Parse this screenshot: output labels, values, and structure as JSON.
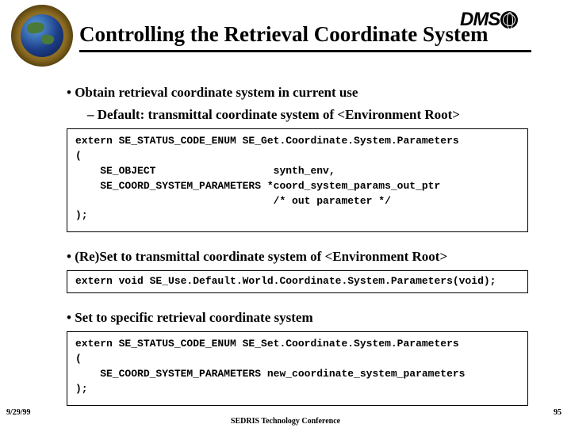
{
  "header": {
    "title": "Controlling the Retrieval Coordinate System",
    "brand_right": {
      "pre": "DMS",
      "post": ""
    }
  },
  "bullets": {
    "b1": "• Obtain retrieval coordinate system in current use",
    "b1_sub": "– Default: transmittal coordinate system of <Environment Root>",
    "b2": "• (Re)Set to transmittal coordinate system of <Environment Root>",
    "b3": "• Set to specific retrieval coordinate system"
  },
  "code": {
    "c1": "extern SE_STATUS_CODE_ENUM SE_Get.Coordinate.System.Parameters\n(\n    SE_OBJECT                   synth_env,\n    SE_COORD_SYSTEM_PARAMETERS *coord_system_params_out_ptr\n                                /* out parameter */\n);",
    "c2": "extern void SE_Use.Default.World.Coordinate.System.Parameters(void);",
    "c3": "extern SE_STATUS_CODE_ENUM SE_Set.Coordinate.System.Parameters\n(\n    SE_COORD_SYSTEM_PARAMETERS new_coordinate_system_parameters\n);"
  },
  "footer": {
    "date": "9/29/99",
    "center": "SEDRIS Technology Conference",
    "page": "95"
  }
}
